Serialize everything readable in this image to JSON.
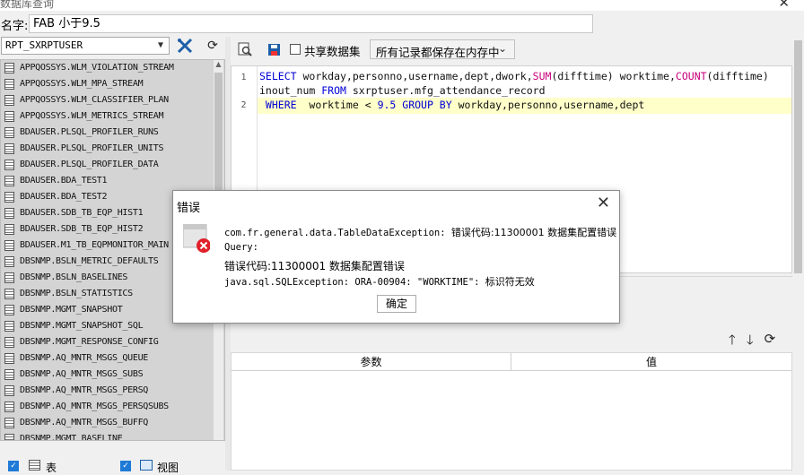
{
  "window": {
    "title": "数据库查询",
    "close": "✕"
  },
  "name_field": {
    "label": "名字:",
    "value": "FAB 小于9.5"
  },
  "db_select": {
    "value": "RPT_SXRPTUSER"
  },
  "table_list": {
    "items": [
      "APPQOSSYS.WLM_VIOLATION_STREAM",
      "APPQOSSYS.WLM_MPA_STREAM",
      "APPQOSSYS.WLM_CLASSIFIER_PLAN",
      "APPQOSSYS.WLM_METRICS_STREAM",
      "BDAUSER.PLSQL_PROFILER_RUNS",
      "BDAUSER.PLSQL_PROFILER_UNITS",
      "BDAUSER.PLSQL_PROFILER_DATA",
      "BDAUSER.BDA_TEST1",
      "BDAUSER.BDA_TEST2",
      "BDAUSER.SDB_TB_EQP_HIST1",
      "BDAUSER.SDB_TB_EQP_HIST2",
      "BDAUSER.M1_TB_EQPMONITOR_MAIN",
      "DBSNMP.BSLN_METRIC_DEFAULTS",
      "DBSNMP.BSLN_BASELINES",
      "DBSNMP.BSLN_STATISTICS",
      "DBSNMP.MGMT_SNAPSHOT",
      "DBSNMP.MGMT_SNAPSHOT_SQL",
      "DBSNMP.MGMT_RESPONSE_CONFIG",
      "DBSNMP.AQ_MNTR_MSGS_QUEUE",
      "DBSNMP.AQ_MNTR_MSGS_SUBS",
      "DBSNMP.AQ_MNTR_MSGS_PERSQ",
      "DBSNMP.AQ_MNTR_MSGS_PERSQSUBS",
      "DBSNMP.AQ_MNTR_MSGS_BUFFQ",
      "DBSNMP.MGMT_BASELINE"
    ]
  },
  "bottom": {
    "table_label": "表",
    "view_label": "视图"
  },
  "toolbar": {
    "share_label": "共享数据集",
    "mode_value": "所有记录都保存在内存中"
  },
  "editor": {
    "line1_no": "1",
    "line2_no": "2",
    "l1": {
      "a": "SELECT",
      "b": " workday,personno,username,dept,dwork,",
      "c": "SUM",
      "d": "(difftime) worktime,",
      "e": "COUNT",
      "f": "(difftime)"
    },
    "l1b": {
      "a": "inout_num ",
      "b": "FROM",
      "c": " sxrptuser.mfg_attendance_record"
    },
    "l2": {
      "a": " WHERE",
      "b": "  worktime < ",
      "c": "9.5",
      "d": " GROUP BY",
      "e": " workday,personno,username,dept"
    }
  },
  "param_table": {
    "col1": "参数",
    "col2": "值"
  },
  "dialog": {
    "title": "错误",
    "line1a": "com.fr.general.data.TableDataException: ",
    "line1b": "错误代码:11300001 数据集配置错误",
    "line2": "Query:",
    "line3": "错误代码:11300001 数据集配置错误",
    "line4a": "java.sql.SQLException: ORA-00904: \"WORKTIME\": ",
    "line4b": "标识符无效",
    "ok": "确定"
  },
  "icons": {
    "tools": "wrench-screwdriver-icon",
    "refresh": "refresh-icon",
    "preview": "preview-icon",
    "save": "save-icon",
    "up": "arrow-up-icon",
    "down": "arrow-down-icon",
    "error": "error-icon"
  },
  "colors": {
    "keyword": "#0000d6",
    "function": "#c8007a",
    "highlight": "#ffffc9",
    "error": "#e0202a",
    "checkbox": "#1e7ad6"
  }
}
